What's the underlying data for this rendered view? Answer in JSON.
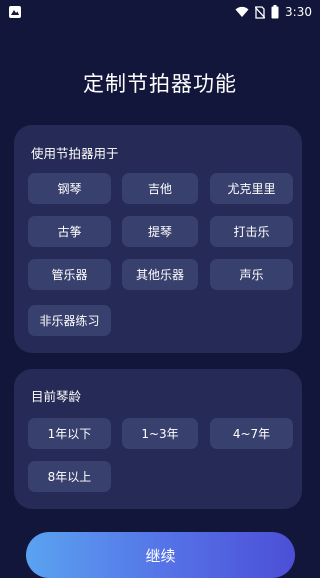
{
  "status_bar": {
    "time": "3:30",
    "icons": [
      "app-notification-icon",
      "wifi-icon",
      "no-sim-icon",
      "battery-icon"
    ]
  },
  "title": "定制节拍器功能",
  "usage_section": {
    "label": "使用节拍器用于",
    "options": [
      "钢琴",
      "吉他",
      "尤克里里",
      "古筝",
      "提琴",
      "打击乐",
      "管乐器",
      "其他乐器",
      "声乐",
      "非乐器练习"
    ]
  },
  "experience_section": {
    "label": "目前琴龄",
    "options": [
      "1年以下",
      "1~3年",
      "4~7年",
      "8年以上"
    ]
  },
  "continue_button": "继续",
  "colors": {
    "background": "#12163a",
    "card": "#252b56",
    "chip": "#38406e",
    "button_gradient_start": "#5aa3f0",
    "button_gradient_end": "#4c4fd6"
  }
}
